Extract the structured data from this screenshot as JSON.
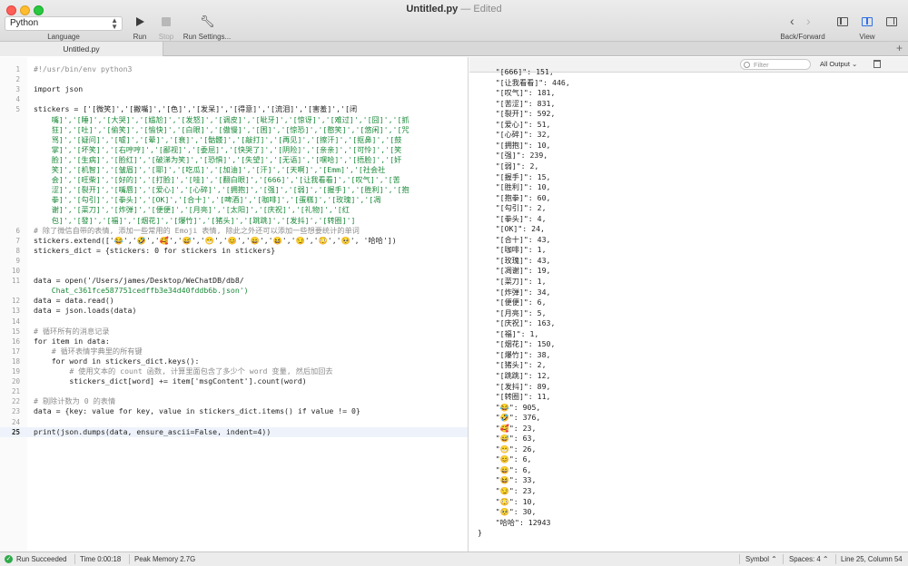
{
  "window": {
    "title": "Untitled.py",
    "edited": "— Edited"
  },
  "toolbar": {
    "language": "Python",
    "language_label": "Language",
    "run_label": "Run",
    "stop_label": "Stop",
    "run_settings_label": "Run Settings...",
    "back_forward_label": "Back/Forward",
    "view_label": "View"
  },
  "tab": {
    "name": "Untitled.py"
  },
  "editor": {
    "current_line": "25",
    "lines": [
      {
        "n": "1",
        "cls": "c-comment",
        "text": "#!/usr/bin/env python3"
      },
      {
        "n": "2",
        "cls": "c-plain",
        "text": ""
      },
      {
        "n": "3",
        "cls": "c-plain",
        "text": "import json"
      },
      {
        "n": "4",
        "cls": "c-plain",
        "text": ""
      },
      {
        "n": "5",
        "cls": "c-plain",
        "text": "stickers = ['[微笑]','[撇嘴]','[色]','[发呆]','[得意]','[流泪]','[害羞]','[闭"
      },
      {
        "n": "",
        "cls": "c-str",
        "text": "    嘴]','[睡]','[大哭]','[尴尬]','[发怒]','[调皮]','[呲牙]','[惊讶]','[难过]','[囧]','[抓"
      },
      {
        "n": "",
        "cls": "c-str",
        "text": "    狂]','[吐]','[偷笑]','[愉快]','[白眼]','[傲慢]','[困]','[惊恐]','[憨笑]','[悠闲]','[咒"
      },
      {
        "n": "",
        "cls": "c-str",
        "text": "    骂]','[疑问]','[嘘]','[晕]','[衰]','[骷髅]','[敲打]','[再见]','[擦汗]','[抠鼻]','[鼓"
      },
      {
        "n": "",
        "cls": "c-str",
        "text": "    掌]','[坏笑]','[右哼哼]','[鄙视]','[委屈]','[快哭了]','[阴险]','[亲亲]','[可怜]','[笑"
      },
      {
        "n": "",
        "cls": "c-str",
        "text": "    脸]','[生病]','[脸红]','[破涕为笑]','[恐惧]','[失望]','[无语]','[嘿哈]','[捂脸]','[奸"
      },
      {
        "n": "",
        "cls": "c-str",
        "text": "    笑]','[机智]','[皱眉]','[耶]','[吃瓜]','[加油]','[汗]','[天啊]','[Emm]','[社会社"
      },
      {
        "n": "",
        "cls": "c-str",
        "text": "    会]','[旺柴]','[好的]','[打脸]','[哇]','[翻白眼]','[666]','[让我看看]','[叹气]','[苦"
      },
      {
        "n": "",
        "cls": "c-str",
        "text": "    涩]','[裂开]','[嘴唇]','[爱心]','[心碎]','[拥抱]','[强]','[弱]','[握手]','[胜利]','[抱"
      },
      {
        "n": "",
        "cls": "c-str",
        "text": "    拳]','[勾引]','[拳头]','[OK]','[合十]','[啤酒]','[咖啡]','[蛋糕]','[玫瑰]','[凋"
      },
      {
        "n": "",
        "cls": "c-str",
        "text": "    谢]','[菜刀]','[炸弹]','[便便]','[月亮]','[太阳]','[庆祝]','[礼物]','[红"
      },
      {
        "n": "",
        "cls": "c-str",
        "text": "    包]','[發]','[福]','[烟花]','[爆竹]','[猪头]','[跳跳]','[发抖]','[转圈]']"
      },
      {
        "n": "6",
        "cls": "c-comment",
        "text": "# 除了微信自带的表情, 添加一些常用的 Emoji 表情, 除此之外还可以添加一些想要统计的单词"
      },
      {
        "n": "7",
        "cls": "c-plain",
        "text": "stickers.extend(['😂','🤣','🥰','😅','😁','😊','😄','😆','😏','😳','🥺', '哈哈'])"
      },
      {
        "n": "8",
        "cls": "c-plain",
        "text": "stickers_dict = {stickers: 0 for stickers in stickers}"
      },
      {
        "n": "9",
        "cls": "c-plain",
        "text": ""
      },
      {
        "n": "10",
        "cls": "c-plain",
        "text": ""
      },
      {
        "n": "11",
        "cls": "c-plain",
        "text": "data = open('/Users/james/Desktop/WeChatDB/db8/"
      },
      {
        "n": "",
        "cls": "c-str",
        "text": "    Chat_c361fce587751cedffb3e34d40fddb6b.json')"
      },
      {
        "n": "12",
        "cls": "c-plain",
        "text": "data = data.read()"
      },
      {
        "n": "13",
        "cls": "c-plain",
        "text": "data = json.loads(data)"
      },
      {
        "n": "14",
        "cls": "c-plain",
        "text": ""
      },
      {
        "n": "15",
        "cls": "c-comment",
        "text": "# 循环所有的消息记录"
      },
      {
        "n": "16",
        "cls": "c-plain",
        "text": "for item in data:"
      },
      {
        "n": "17",
        "cls": "c-comment",
        "text": "    # 循环表情字典里的所有键"
      },
      {
        "n": "18",
        "cls": "c-plain",
        "text": "    for word in stickers_dict.keys():"
      },
      {
        "n": "19",
        "cls": "c-comment",
        "text": "        # 使用文本的 count 函数, 计算里面包含了多少个 word 变量, 然后加回去"
      },
      {
        "n": "20",
        "cls": "c-plain",
        "text": "        stickers_dict[word] += item['msgContent'].count(word)"
      },
      {
        "n": "21",
        "cls": "c-plain",
        "text": ""
      },
      {
        "n": "22",
        "cls": "c-comment",
        "text": "# 剔除计数为 0 的表情"
      },
      {
        "n": "23",
        "cls": "c-plain",
        "text": "data = {key: value for key, value in stickers_dict.items() if value != 0}"
      },
      {
        "n": "24",
        "cls": "c-plain",
        "text": ""
      },
      {
        "n": "25",
        "cls": "c-plain",
        "text": "print(json.dumps(data, ensure_ascii=False, indent=4))"
      }
    ]
  },
  "output": {
    "filter_placeholder": "Filter",
    "all_output": "All Output ⌄",
    "lines": [
      "    \"[666]\": 151,",
      "    \"[让我看看]\": 446,",
      "    \"[叹气]\": 181,",
      "    \"[苦涩]\": 831,",
      "    \"[裂开]\": 592,",
      "    \"[爱心]\": 51,",
      "    \"[心碎]\": 32,",
      "    \"[拥抱]\": 10,",
      "    \"[强]\": 239,",
      "    \"[弱]\": 2,",
      "    \"[握手]\": 15,",
      "    \"[胜利]\": 10,",
      "    \"[抱拳]\": 60,",
      "    \"[勾引]\": 2,",
      "    \"[拳头]\": 4,",
      "    \"[OK]\": 24,",
      "    \"[合十]\": 43,",
      "    \"[咖啡]\": 1,",
      "    \"[玫瑰]\": 43,",
      "    \"[凋谢]\": 19,",
      "    \"[菜刀]\": 1,",
      "    \"[炸弹]\": 34,",
      "    \"[便便]\": 6,",
      "    \"[月亮]\": 5,",
      "    \"[庆祝]\": 163,",
      "    \"[福]\": 1,",
      "    \"[烟花]\": 150,",
      "    \"[爆竹]\": 38,",
      "    \"[猪头]\": 2,",
      "    \"[跳跳]\": 12,",
      "    \"[发抖]\": 89,",
      "    \"[转圈]\": 11,",
      "    \"😂\": 905,",
      "    \"🤣\": 376,",
      "    \"🥰\": 23,",
      "    \"😅\": 63,",
      "    \"😁\": 26,",
      "    \"😊\": 6,",
      "    \"😄\": 6,",
      "    \"😆\": 33,",
      "    \"😏\": 23,",
      "    \"😳\": 10,",
      "    \"🥺\": 30,",
      "    \"哈哈\": 12943",
      "}"
    ]
  },
  "status": {
    "run_state": "Run Succeeded",
    "time": "Time 0:00:18",
    "memory": "Peak Memory 2.7G",
    "symbol": "Symbol ⌃",
    "spaces": "Spaces: 4 ⌃",
    "position": "Line 25, Column 54"
  }
}
